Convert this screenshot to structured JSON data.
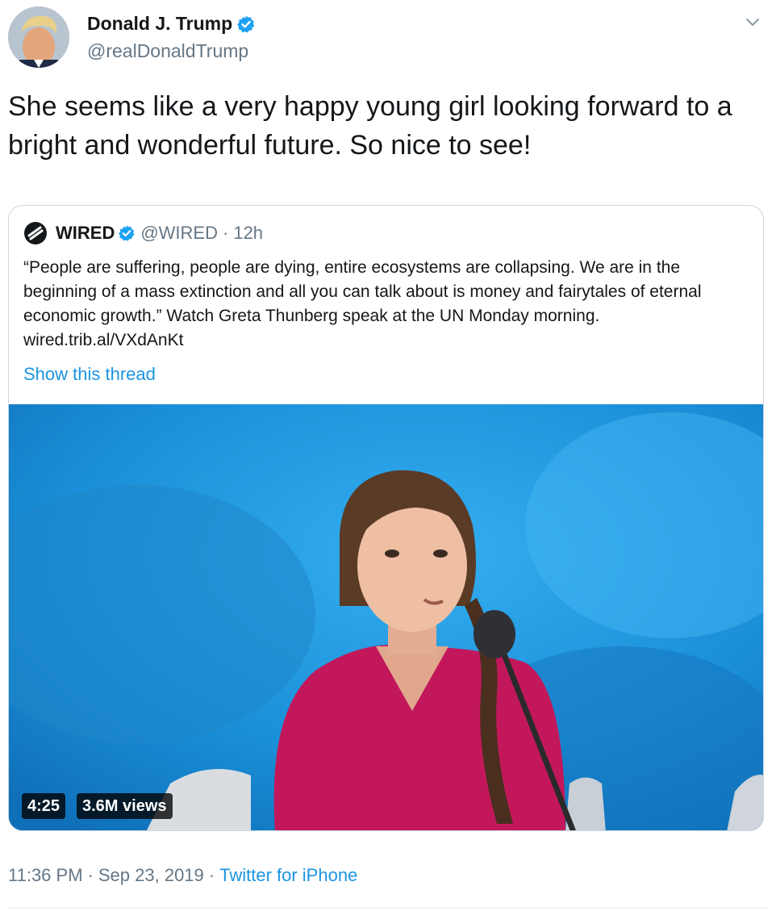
{
  "author": {
    "display_name": "Donald J. Trump",
    "handle": "@realDonaldTrump",
    "verified": true,
    "avatar_icon": "profile-photo"
  },
  "tweet": {
    "text": "She seems like a very happy young girl looking forward to a bright and wonderful future. So nice to see!"
  },
  "quoted": {
    "display_name": "WIRED",
    "handle": "@WIRED",
    "separator": "·",
    "time": "12h",
    "verified": true,
    "text": "“People are suffering, people are dying, entire ecosystems are collapsing. We are in the beginning of a mass extinction and all you can talk about is money and fairytales of eternal economic growth.” Watch Greta Thunberg speak at the UN Monday morning. wired.trib.al/VXdAnKt",
    "show_thread": "Show this thread",
    "video": {
      "duration": "4:25",
      "views": "3.6M views"
    }
  },
  "footer": {
    "time": "11:36 PM",
    "sep1": "·",
    "date": "Sep 23, 2019",
    "sep2": "·",
    "source": "Twitter for iPhone"
  },
  "colors": {
    "link": "#1b95e0",
    "secondary_text": "#657786",
    "verified_badge": "#1da1f2",
    "border": "#ccd6dd"
  }
}
